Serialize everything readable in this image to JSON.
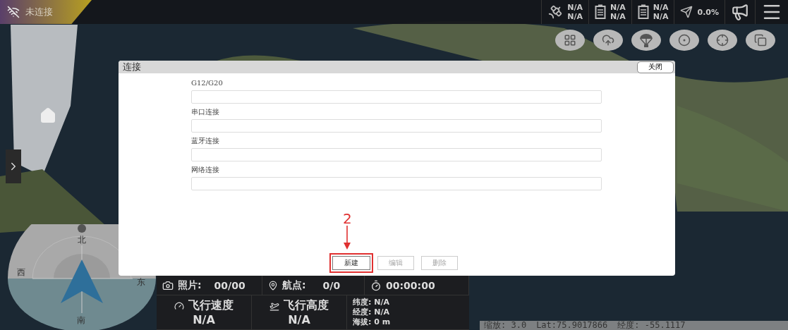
{
  "status": {
    "connection": "未连接"
  },
  "telemetry": [
    {
      "kind": "satellite",
      "lines": [
        "N/A",
        "N/A"
      ]
    },
    {
      "kind": "battery",
      "lines": [
        "N/A",
        "N/A"
      ]
    },
    {
      "kind": "battery",
      "lines": [
        "N/A",
        "N/A"
      ]
    },
    {
      "kind": "signal",
      "lines": [
        "0.0%"
      ]
    }
  ],
  "map_tools": [
    {
      "kind": "tiles"
    },
    {
      "kind": "upload"
    },
    {
      "kind": "parachute"
    },
    {
      "kind": "gimbal"
    },
    {
      "kind": "locate"
    },
    {
      "kind": "layers"
    }
  ],
  "dialog": {
    "title": "连接",
    "close": "关闭",
    "sections": [
      {
        "label": "G12/G20"
      },
      {
        "label": "串口连接"
      },
      {
        "label": "蓝牙连接"
      },
      {
        "label": "网络连接"
      }
    ],
    "buttons": [
      {
        "label": "新建",
        "disabled": false,
        "annotated": true
      },
      {
        "label": "编辑",
        "disabled": true,
        "annotated": false
      },
      {
        "label": "删除",
        "disabled": true,
        "annotated": false
      }
    ]
  },
  "annotation": {
    "label": "2"
  },
  "compass": {
    "north": "北",
    "west": "西",
    "east": "东",
    "south": "南"
  },
  "flight_info": {
    "photos": {
      "label": "照片:",
      "value": "00/00"
    },
    "waypoints": {
      "label": "航点:",
      "value": "0/0"
    },
    "timer": "00:00:00",
    "speed": {
      "label": "飞行速度",
      "value": "N/A"
    },
    "altitude": {
      "label": "飞行高度",
      "value": "N/A"
    },
    "position": [
      "纬度: N/A",
      "经度: N/A",
      "海拔: 0 m"
    ]
  },
  "map_status": [
    "缩放: 3.0",
    "Lat:75.9017866",
    "经度: -55.1117"
  ]
}
